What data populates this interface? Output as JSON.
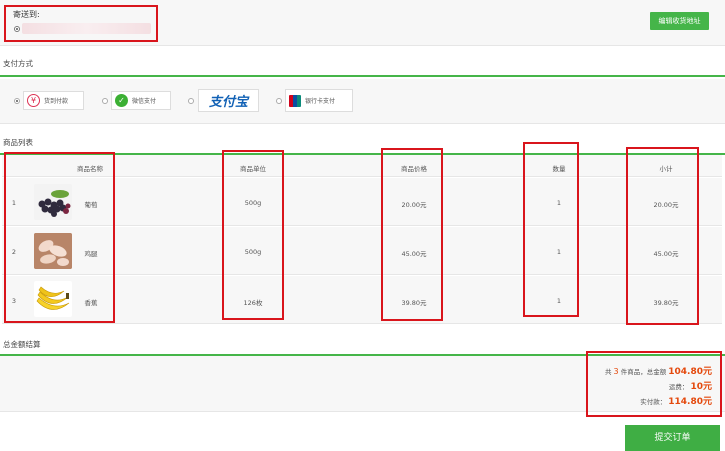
{
  "address": {
    "title": "寄送到:",
    "edit_button": "编辑收货地址"
  },
  "payment": {
    "section_title": "支付方式",
    "options": [
      {
        "label": "货到付款",
        "icon": "cash-on-delivery-icon",
        "selected": true
      },
      {
        "label": "微信支付",
        "icon": "wechat-pay-icon",
        "selected": false
      },
      {
        "label": "支付宝",
        "icon": "alipay-logo",
        "selected": false
      },
      {
        "label": "银行卡支付",
        "icon": "unionpay-icon",
        "selected": false
      }
    ]
  },
  "products": {
    "section_title": "商品列表",
    "headers": [
      "商品名称",
      "商品单位",
      "商品价格",
      "数量",
      "小计"
    ],
    "rows": [
      {
        "index": "1",
        "name": "葡萄",
        "unit": "500g",
        "price": "20.00元",
        "qty": "1",
        "subtotal": "20.00元",
        "image": "grapes-image"
      },
      {
        "index": "2",
        "name": "鸡腿",
        "unit": "500g",
        "price": "45.00元",
        "qty": "1",
        "subtotal": "45.00元",
        "image": "chicken-legs-image"
      },
      {
        "index": "3",
        "name": "香蕉",
        "unit": "126枚",
        "price": "39.80元",
        "qty": "1",
        "subtotal": "39.80元",
        "image": "bananas-image"
      }
    ]
  },
  "summary": {
    "section_title": "总金额结算",
    "count_prefix": "共",
    "count": "3",
    "count_suffix": "件商品，总金额",
    "total": "104.80元",
    "shipping_label": "运费：",
    "shipping": "10元",
    "paid_label": "实付款：",
    "paid": "114.80元"
  },
  "submit_button": "提交订单",
  "colors": {
    "accent": "#45b549",
    "highlight": "#e4490d",
    "annotation": "#d9151c"
  }
}
